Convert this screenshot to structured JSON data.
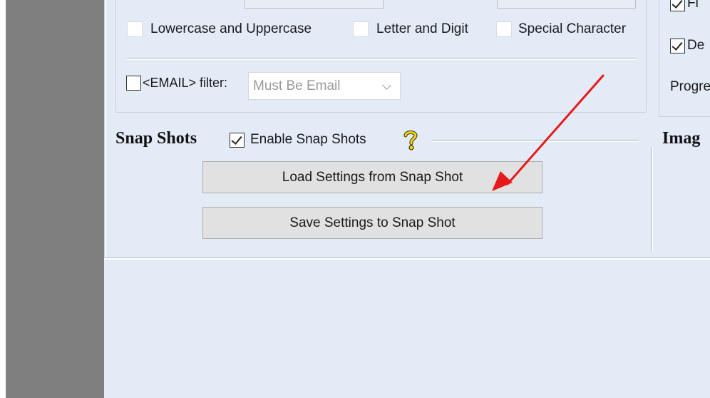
{
  "filters": {
    "lowercase_uppercase": "Lowercase and Uppercase",
    "letter_digit": "Letter and Digit",
    "special_character": "Special Character",
    "email_filter_label": "<EMAIL> filter:",
    "email_filter_value": "Must Be Email"
  },
  "snap_shots": {
    "title": "Snap Shots",
    "enable_label": "Enable Snap Shots",
    "load_button": "Load Settings from Snap Shot",
    "save_button": "Save Settings to Snap Shot"
  },
  "right_panel": {
    "option_1_partial": "Fi",
    "option_2_partial": "De",
    "progress_partial": "Progre",
    "image_title_partial": "Imag"
  },
  "colors": {
    "panel_bg": "#e3ebf7",
    "sidebar": "#7f7f7f",
    "annotation_arrow": "#e8191a",
    "button_bg": "#e1e1e1"
  },
  "icons": {
    "help": "question-mark-icon",
    "dropdown": "chevron-down-icon"
  }
}
